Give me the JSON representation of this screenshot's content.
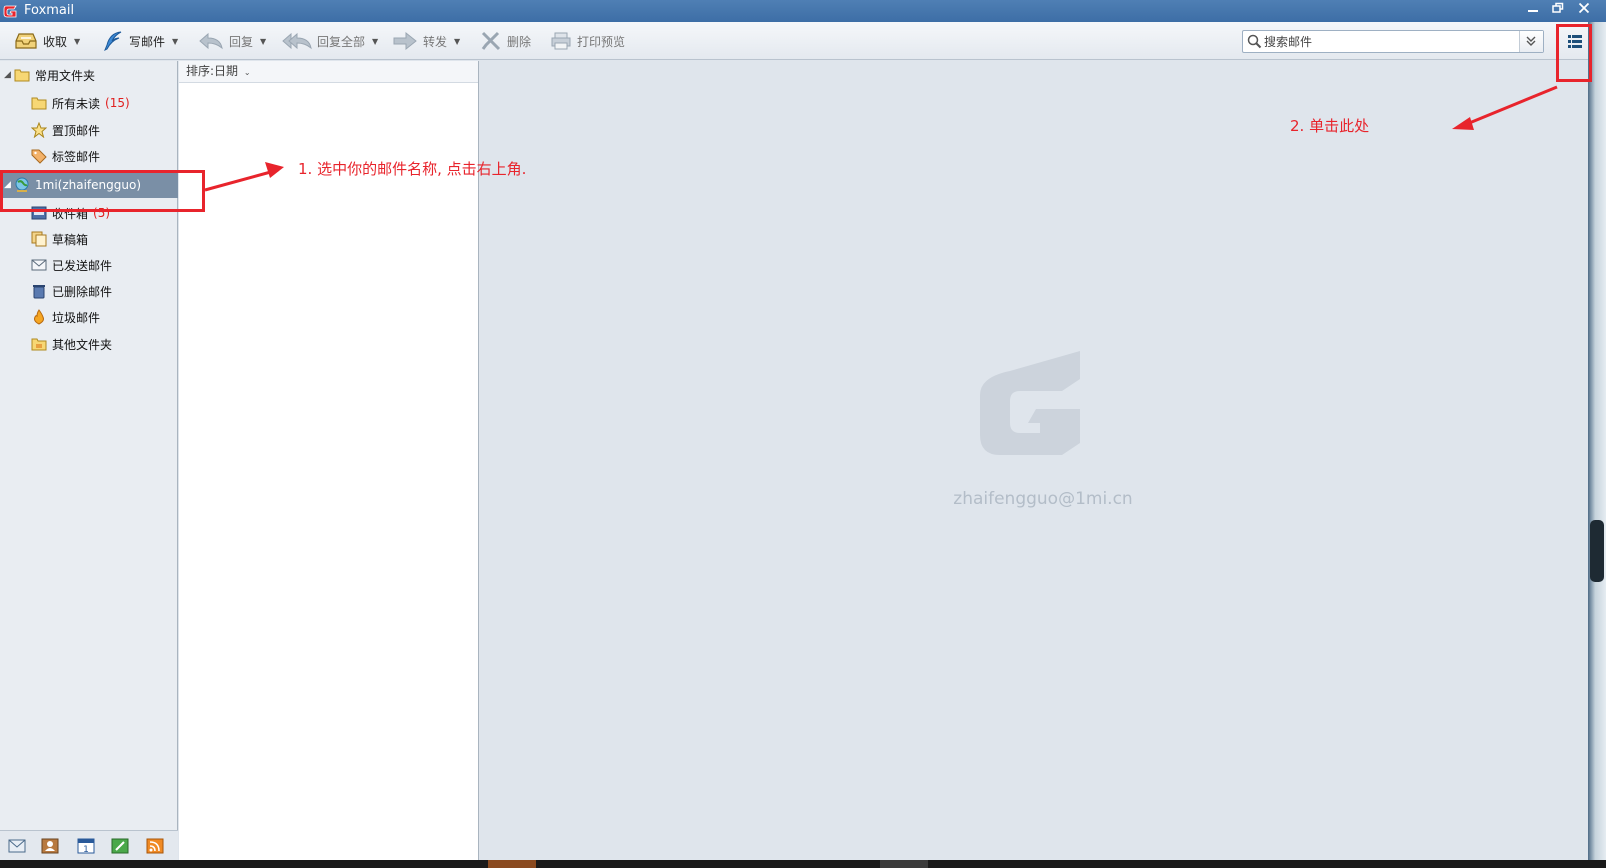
{
  "window": {
    "title": "Foxmail"
  },
  "toolbar": {
    "receive": "收取",
    "compose": "写邮件",
    "reply": "回复",
    "reply_all": "回复全部",
    "forward": "转发",
    "delete": "删除",
    "print_preview": "打印预览"
  },
  "search": {
    "placeholder": "搜索邮件"
  },
  "sidebar": {
    "common_folders": "常用文件夹",
    "all_unread": "所有未读",
    "all_unread_count": "(15)",
    "pinned": "置顶邮件",
    "tagged": "标签邮件",
    "account": "1mi(zhaifengguo)",
    "inbox": "收件箱",
    "inbox_count": "(5)",
    "drafts": "草稿箱",
    "sent": "已发送邮件",
    "deleted": "已删除邮件",
    "spam": "垃圾邮件",
    "other": "其他文件夹"
  },
  "maillist": {
    "sort_label": "排序:日期"
  },
  "preview": {
    "account_email": "zhaifengguo@1mi.cn"
  },
  "annotations": {
    "step1": "1. 选中你的邮件名称, 点击右上角.",
    "step2": "2. 单击此处"
  },
  "colors": {
    "accent_red": "#e8242c",
    "title_blue": "#3d6ea6",
    "selected_row": "#7a8fa6"
  }
}
